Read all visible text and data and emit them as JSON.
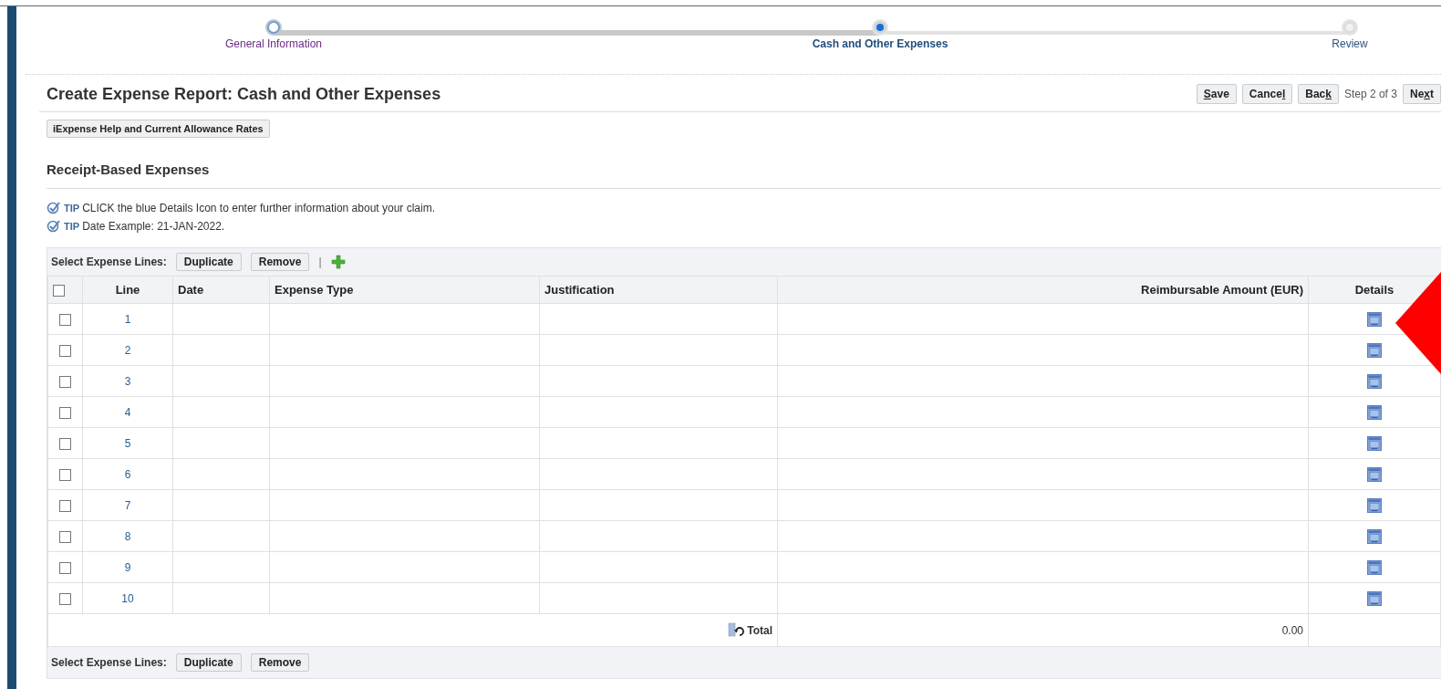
{
  "train": [
    {
      "label": "General Information",
      "visited": true,
      "selected": false
    },
    {
      "label": "Cash and Other Expenses",
      "selected": true
    },
    {
      "label": "Review",
      "visited": false,
      "selected": false
    }
  ],
  "page_title": "Create Expense Report: Cash and Other Expenses",
  "actions": [
    {
      "kind": "button",
      "key": "S",
      "after": "ave"
    },
    {
      "kind": "button",
      "before": "Cance",
      "key": "l"
    },
    {
      "kind": "button",
      "before": "Bac",
      "key": "k"
    },
    {
      "kind": "text",
      "before": "Step 2 of 3"
    },
    {
      "kind": "button",
      "before": "Ne",
      "key": "x",
      "after": "t"
    }
  ],
  "help_button": "iExpense Help and Current Allowance Rates",
  "section_title": "Receipt-Based Expenses",
  "tips": [
    {
      "badge": "TIP",
      "text": "CLICK the blue Details Icon to enter further information about your claim."
    },
    {
      "badge": "TIP",
      "text": "Date Example: 21-JAN-2022."
    }
  ],
  "top_toolbar": {
    "label": "Select Expense Lines:",
    "buttons": [
      "Duplicate",
      "Remove"
    ],
    "separator": "|",
    "add": true
  },
  "table": {
    "select_all_checked": false,
    "columns": [
      "Line",
      "Date",
      "Expense Type",
      "Justification",
      "Reimbursable Amount (EUR)",
      "Details"
    ],
    "rows": [
      {
        "line": "1",
        "checked": false
      },
      {
        "line": "2",
        "checked": false
      },
      {
        "line": "3",
        "checked": false
      },
      {
        "line": "4",
        "checked": false
      },
      {
        "line": "5",
        "checked": false
      },
      {
        "line": "6",
        "checked": false
      },
      {
        "line": "7",
        "checked": false
      },
      {
        "line": "8",
        "checked": false
      },
      {
        "line": "9",
        "checked": false
      },
      {
        "line": "10",
        "checked": false
      }
    ],
    "total_label": "Total",
    "total_amount": "0.00"
  },
  "bottom_toolbar": {
    "label": "Select Expense Lines:",
    "buttons": [
      "Duplicate",
      "Remove"
    ]
  }
}
